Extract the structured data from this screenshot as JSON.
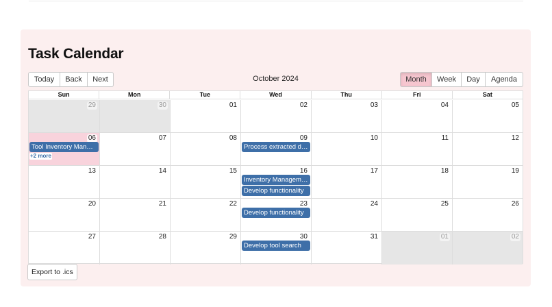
{
  "calendar": {
    "title": "Task Calendar",
    "nav": {
      "today": "Today",
      "back": "Back",
      "next": "Next"
    },
    "period_label": "October 2024",
    "views": {
      "month": "Month",
      "week": "Week",
      "day": "Day",
      "agenda": "Agenda"
    },
    "active_view": "Month",
    "weekdays": [
      "Sun",
      "Mon",
      "Tue",
      "Wed",
      "Thu",
      "Fri",
      "Sat"
    ],
    "weeks": [
      [
        {
          "d": "29",
          "off": true
        },
        {
          "d": "30",
          "off": true
        },
        {
          "d": "01"
        },
        {
          "d": "02"
        },
        {
          "d": "03"
        },
        {
          "d": "04"
        },
        {
          "d": "05"
        }
      ],
      [
        {
          "d": "06",
          "today": true
        },
        {
          "d": "07"
        },
        {
          "d": "08"
        },
        {
          "d": "09"
        },
        {
          "d": "10"
        },
        {
          "d": "11"
        },
        {
          "d": "12"
        }
      ],
      [
        {
          "d": "13"
        },
        {
          "d": "14"
        },
        {
          "d": "15"
        },
        {
          "d": "16"
        },
        {
          "d": "17"
        },
        {
          "d": "18"
        },
        {
          "d": "19"
        }
      ],
      [
        {
          "d": "20"
        },
        {
          "d": "21"
        },
        {
          "d": "22"
        },
        {
          "d": "23"
        },
        {
          "d": "24"
        },
        {
          "d": "25"
        },
        {
          "d": "26"
        }
      ],
      [
        {
          "d": "27"
        },
        {
          "d": "28"
        },
        {
          "d": "29"
        },
        {
          "d": "30"
        },
        {
          "d": "31"
        },
        {
          "d": "01",
          "off": true
        },
        {
          "d": "02",
          "off": true
        }
      ]
    ],
    "events": [
      {
        "week": 1,
        "day": 0,
        "slot": 0,
        "label": "Tool Inventory Management"
      },
      {
        "week": 1,
        "day": 3,
        "slot": 0,
        "label": "Process extracted data"
      },
      {
        "week": 2,
        "day": 3,
        "slot": 0,
        "label": "Inventory Management"
      },
      {
        "week": 2,
        "day": 3,
        "slot": 1,
        "label": "Develop functionality"
      },
      {
        "week": 3,
        "day": 3,
        "slot": 0,
        "label": "Develop functionality"
      },
      {
        "week": 4,
        "day": 3,
        "slot": 0,
        "label": "Develop tool search"
      }
    ],
    "more_links": [
      {
        "week": 1,
        "day": 0,
        "slot": 1,
        "label": "+2 more"
      }
    ],
    "export_label": "Export to .ics",
    "colors": {
      "event": "#3e6fa8",
      "today": "#f8d3dc",
      "active_view": "#f6c6cf",
      "background": "#fcefef"
    }
  }
}
